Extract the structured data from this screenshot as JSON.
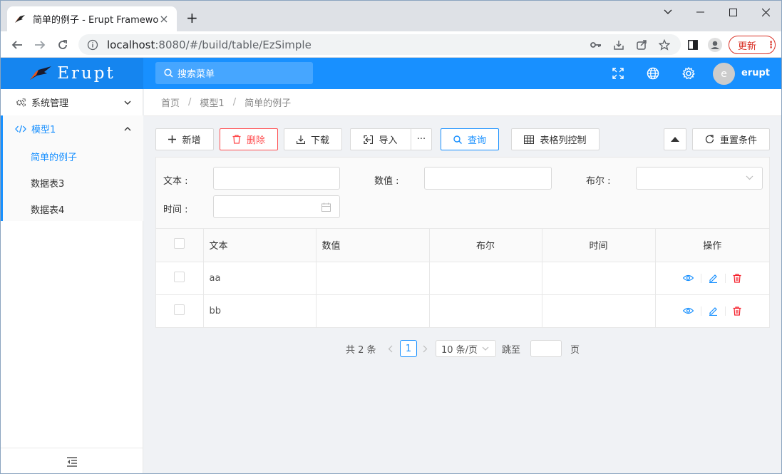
{
  "browser": {
    "tab_title": "简单的例子 - Erupt Framework",
    "url_host": "localhost",
    "url_rest": ":8080/#/build/table/EzSimple",
    "update_label": "更新"
  },
  "header": {
    "logo_text": "Erupt",
    "search_placeholder": "搜索菜单",
    "avatar_letter": "e",
    "username": "erupt"
  },
  "sidebar": {
    "items": [
      {
        "label": "系统管理"
      },
      {
        "label": "模型1"
      }
    ],
    "subitems": [
      {
        "label": "简单的例子"
      },
      {
        "label": "数据表3"
      },
      {
        "label": "数据表4"
      }
    ]
  },
  "breadcrumb": [
    "首页",
    "模型1",
    "简单的例子"
  ],
  "toolbar": {
    "add": "新增",
    "delete": "删除",
    "download": "下载",
    "import": "导入",
    "more": "···",
    "query": "查询",
    "columns": "表格列控制",
    "reset": "重置条件"
  },
  "filter": {
    "text_label": "文本 :",
    "number_label": "数值 :",
    "bool_label": "布尔 :",
    "time_label": "时间 :"
  },
  "table": {
    "headers": [
      "文本",
      "数值",
      "布尔",
      "时间",
      "操作"
    ],
    "rows": [
      {
        "text": "aa",
        "number": "",
        "bool": "",
        "time": ""
      },
      {
        "text": "bb",
        "number": "",
        "bool": "",
        "time": ""
      }
    ]
  },
  "pagination": {
    "total": "共 2 条",
    "current_page": "1",
    "page_size": "10 条/页",
    "jump_label": "跳至",
    "page_label": "页"
  },
  "colors": {
    "primary": "#1890ff",
    "danger": "#ff4d4f",
    "header_bg": "#1890ff"
  }
}
